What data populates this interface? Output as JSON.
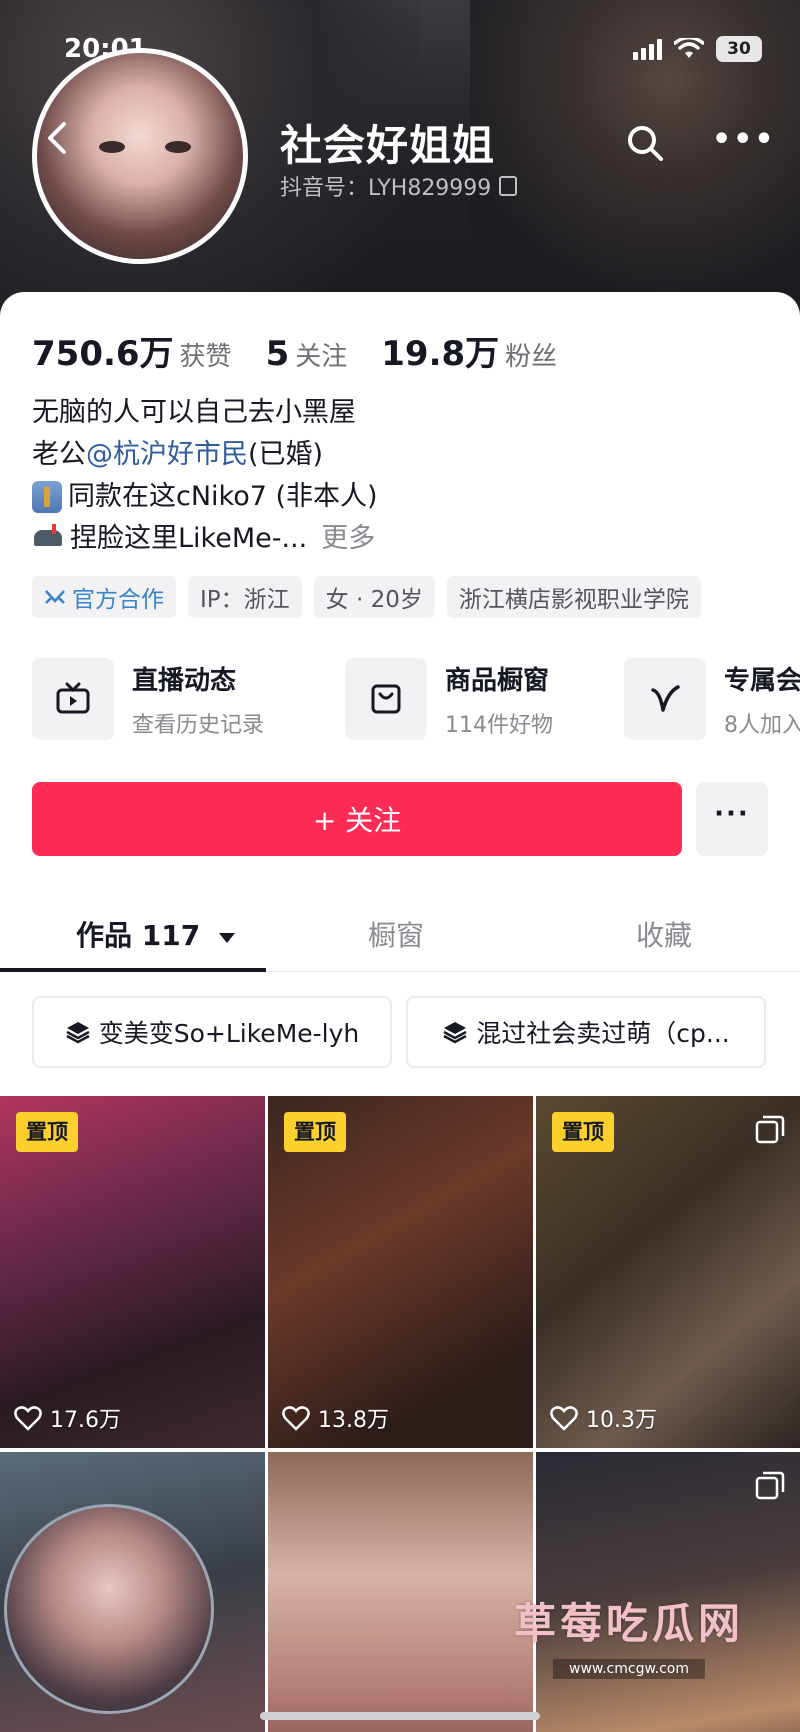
{
  "status_bar": {
    "time": "20:01",
    "battery": "30"
  },
  "profile": {
    "nickname": "社会好姐姐",
    "douyin_id": "抖音号：LYH829999"
  },
  "stats": [
    {
      "value": "750.6万",
      "label": "获赞"
    },
    {
      "value": "5",
      "label": "关注"
    },
    {
      "value": "19.8万",
      "label": "粉丝"
    }
  ],
  "bio": {
    "line1": "无脑的人可以自己去小黑屋",
    "line2_prefix": "老公",
    "line2_mention": "@杭沪好市民",
    "line2_suffix": "(已婚)",
    "line3": "同款在这cNiko7 (非本人)",
    "line4": "捏脸这里LikeMe-...",
    "more": "更多"
  },
  "tags": [
    "官方合作",
    "IP：浙江",
    "女 · 20岁",
    "浙江横店影视职业学院"
  ],
  "services": [
    {
      "title": "直播动态",
      "sub": "查看历史记录",
      "icon": "tv-icon"
    },
    {
      "title": "商品橱窗",
      "sub": "114件好物",
      "icon": "shopping-bag-icon"
    },
    {
      "title": "专属会",
      "sub": "8人加入",
      "icon": "v-icon"
    }
  ],
  "follow": {
    "label": "+ 关注",
    "more": "···"
  },
  "tabs": [
    {
      "label": "作品 117",
      "active": true
    },
    {
      "label": "橱窗",
      "active": false
    },
    {
      "label": "收藏",
      "active": false
    }
  ],
  "collections": [
    "变美变So+LikeMe-lyh",
    "混过社会卖过萌（cp..."
  ],
  "videos": [
    {
      "pinned": true,
      "pin_label": "置顶",
      "likes": "17.6万",
      "multi": false
    },
    {
      "pinned": true,
      "pin_label": "置顶",
      "likes": "13.8万",
      "multi": false
    },
    {
      "pinned": true,
      "pin_label": "置顶",
      "likes": "10.3万",
      "multi": true
    },
    {
      "pinned": false,
      "likes": "",
      "multi": false
    },
    {
      "pinned": false,
      "likes": "",
      "multi": false
    },
    {
      "pinned": false,
      "likes": "",
      "multi": true
    }
  ],
  "watermark": {
    "title": "草莓吃瓜网",
    "url": "www.cmcgw.com"
  },
  "colors": {
    "accent": "#fe2c55",
    "mention": "#2f5d9e",
    "pin": "#fcd02c"
  }
}
